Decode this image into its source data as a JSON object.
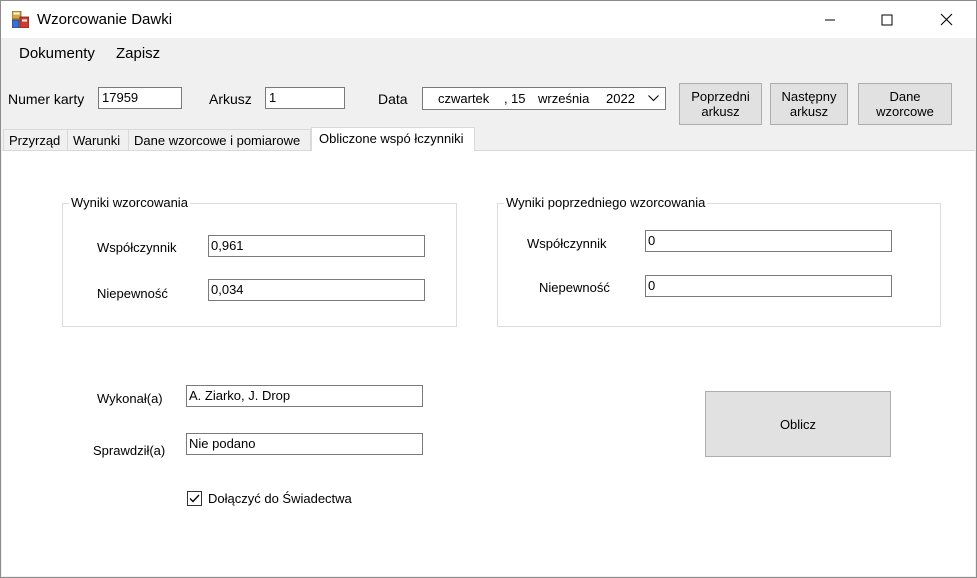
{
  "window": {
    "title": "Wzorcowanie Dawki"
  },
  "menu": {
    "items": [
      "Dokumenty",
      "Zapisz"
    ]
  },
  "toolbar": {
    "card_label": "Numer karty",
    "card_value": "17959",
    "sheet_label": "Arkusz",
    "sheet_value": "1",
    "date_label": "Data",
    "date": {
      "weekday": "czwartek",
      "sep": ",",
      "day": "15",
      "month": "września",
      "year": "2022"
    },
    "prev_button": [
      "Poprzedni",
      "arkusz"
    ],
    "next_button": [
      "Następny",
      "arkusz"
    ],
    "ref_button": [
      "Dane",
      "wzorcowe"
    ]
  },
  "tabs": [
    {
      "label": "Przyrząd",
      "active": false
    },
    {
      "label": "Warunki",
      "active": false
    },
    {
      "label": "Dane wzorcowe i pomiarowe",
      "active": false
    },
    {
      "label": "Obliczone wspó łczynniki",
      "active": true
    }
  ],
  "results": {
    "title": "Wyniki wzorcowania",
    "coef_label": "Współczynnik",
    "coef_value": "0,961",
    "unc_label": "Niepewność",
    "unc_value": "0,034"
  },
  "previous": {
    "title": "Wyniki poprzedniego wzorcowania",
    "coef_label": "Współczynnik",
    "coef_value": "0",
    "unc_label": "Niepewność",
    "unc_value": "0"
  },
  "signoff": {
    "performed_label": "Wykonał(a)",
    "performed_value": "A. Ziarko, J. Drop",
    "checked_label": "Sprawdził(a)",
    "checked_value": "Nie podano",
    "attach_label": "Dołączyć do Świadectwa",
    "attach_checked": true
  },
  "calculate_button": "Oblicz"
}
